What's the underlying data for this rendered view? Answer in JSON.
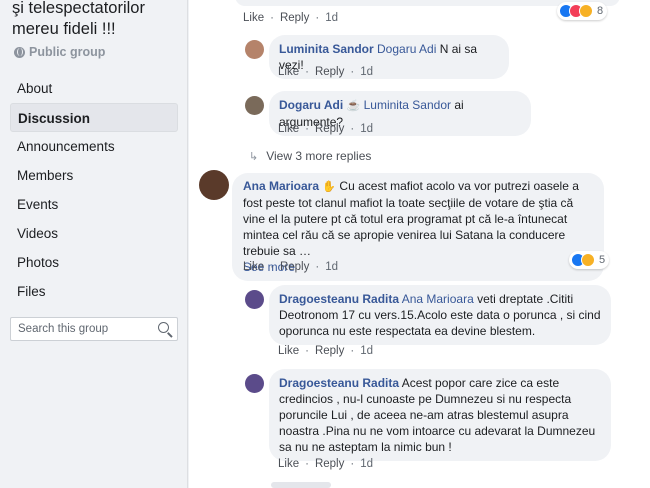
{
  "sidebar": {
    "group_title": "şi telespectatorilor mereu fideli !!!",
    "privacy": "Public group",
    "nav": [
      {
        "label": "About",
        "active": false
      },
      {
        "label": "Discussion",
        "active": true
      },
      {
        "label": "Announcements",
        "active": false
      },
      {
        "label": "Members",
        "active": false
      },
      {
        "label": "Events",
        "active": false
      },
      {
        "label": "Videos",
        "active": false
      },
      {
        "label": "Photos",
        "active": false
      },
      {
        "label": "Files",
        "active": false
      }
    ],
    "search_placeholder": "Search this group"
  },
  "feed": {
    "top_comment": {
      "like": "Like",
      "reply": "Reply",
      "time": "1d",
      "reaction_count": "8"
    },
    "reply1": {
      "author": "Luminita Sandor",
      "mention": "Dogaru Adi",
      "text": "N ai sa vezi!",
      "like": "Like",
      "reply": "Reply",
      "time": "1d"
    },
    "reply2": {
      "author": "Dogaru Adi",
      "mention": "Luminita Sandor",
      "text": "ai argumente?",
      "like": "Like",
      "reply": "Reply",
      "time": "1d"
    },
    "view_more": "View 3 more replies",
    "comment2": {
      "author": "Ana Marioara",
      "text": "Cu acest mafiot acolo va vor putrezi oasele a fost peste tot clanul mafiot la toate secţiile de votare de ştia că vine el la putere pt că totul era programat pt că le-a întunecat mintea cel rău că se apropie venirea lui Satana la conducere trebuie sa …",
      "see_more": "See more",
      "like": "Like",
      "reply": "Reply",
      "time": "1d",
      "reaction_count": "5"
    },
    "reply3": {
      "author": "Dragoesteanu Radita",
      "mention": "Ana Marioara",
      "text": "veti dreptate .Cititi Deotronom 17 cu vers.15.Acolo este data o porunca , si cind oporunca nu este respectata ea devine blestem.",
      "like": "Like",
      "reply": "Reply",
      "time": "1d"
    },
    "reply4": {
      "author": "Dragoesteanu Radita",
      "text": "Acest popor care zice ca este credincios , nu-l cunoaste pe Dumnezeu si nu respecta poruncile Lui , de aceea ne-am atras blestemul asupra noastra .Pina nu ne vom intoarce cu adevarat la Dumnezeu sa nu ne asteptam la nimic bun !",
      "like": "Like",
      "reply": "Reply",
      "time": "1d"
    }
  },
  "colors": {
    "link_blue": "#385898",
    "bubble_bg": "#f0f2f5",
    "meta_gray": "#606770"
  }
}
